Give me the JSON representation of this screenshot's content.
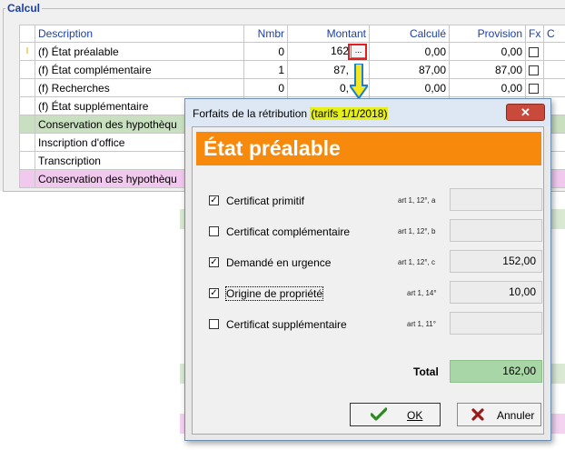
{
  "calc": {
    "title": "Calcul",
    "headers": [
      "",
      "Description",
      "Nmbr",
      "Montant",
      "Calculé",
      "Provision",
      "Fx",
      "C"
    ],
    "rows": [
      {
        "indicator": "I",
        "desc": "(f) État préalable",
        "nmbr": "0",
        "montant": "162",
        "calcule": "0,00",
        "provision": "0,00",
        "style": ""
      },
      {
        "indicator": "",
        "desc": "(f) État complémentaire",
        "nmbr": "1",
        "montant": "87,",
        "calcule": "87,00",
        "provision": "87,00",
        "style": ""
      },
      {
        "indicator": "",
        "desc": "(f) Recherches",
        "nmbr": "0",
        "montant": "0,",
        "calcule": "0,00",
        "provision": "0,00",
        "style": ""
      },
      {
        "indicator": "",
        "desc": "(f) État supplémentaire",
        "nmbr": "",
        "montant": "",
        "calcule": "",
        "provision": "",
        "style": ""
      },
      {
        "indicator": "",
        "desc": "Conservation des hypothèqu",
        "nmbr": "",
        "montant": "",
        "calcule": "",
        "provision": "",
        "style": "green"
      },
      {
        "indicator": "",
        "desc": "Inscription d'office",
        "nmbr": "",
        "montant": "",
        "calcule": "",
        "provision": "",
        "style": ""
      },
      {
        "indicator": "",
        "desc": "Transcription",
        "nmbr": "",
        "montant": "",
        "calcule": "",
        "provision": "",
        "style": ""
      },
      {
        "indicator": "",
        "desc": "Conservation des hypothèqu",
        "nmbr": "",
        "montant": "",
        "calcule": "",
        "provision": "",
        "style": "pink"
      }
    ],
    "ellipsis": "..."
  },
  "dialog": {
    "title_prefix": "Forfaits de la rétribution ",
    "title_highlight": "(tarifs 1/1/2018)",
    "close": "✕",
    "banner": "État préalable",
    "items": [
      {
        "label": "Certificat primitif",
        "checked": true,
        "art": "art 1, 12°, a",
        "value": ""
      },
      {
        "label": "Certificat complémentaire",
        "checked": false,
        "art": "art 1, 12°, b",
        "value": ""
      },
      {
        "label": "Demandé en urgence",
        "checked": true,
        "art": "art 1, 12°, c",
        "value": "152,00"
      },
      {
        "label": "Origine de propriété",
        "checked": true,
        "art": "art 1, 14°",
        "value": "10,00"
      },
      {
        "label": "Certificat supplémentaire",
        "checked": false,
        "art": "art 1, 11°",
        "value": ""
      }
    ],
    "total_label": "Total",
    "total_value": "162,00",
    "ok_label": "OK",
    "cancel_label": "Annuler",
    "colors": {
      "banner": "#f7890c",
      "total": "#a8d6a6",
      "highlight": "#e6ef1a",
      "close": "#c94a3b"
    }
  }
}
